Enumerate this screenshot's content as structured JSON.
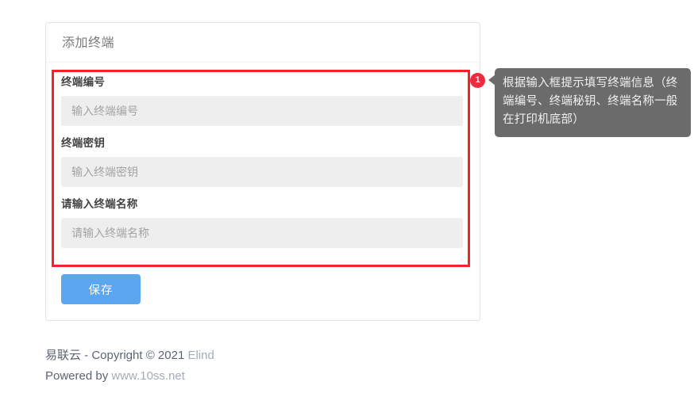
{
  "card": {
    "title": "添加终端",
    "fields": [
      {
        "label": "终端编号",
        "value": "",
        "placeholder": "输入终端编号"
      },
      {
        "label": "终端密钥",
        "value": "",
        "placeholder": "输入终端密钥"
      },
      {
        "label": "请输入终端名称",
        "value": "",
        "placeholder": "请输入终端名称"
      }
    ],
    "save_label": "保存"
  },
  "callout": {
    "badge": "1",
    "text": "根据输入框提示填写终端信息（终端编号、终端秘钥、终端名称一般在打印机底部）"
  },
  "footer": {
    "line1_prefix": "易联云 - Copyright © 2021 ",
    "line1_muted": "Elind",
    "line2_prefix": "Powered by ",
    "line2_muted": "www.10ss.net"
  },
  "colors": {
    "highlight": "#f22424",
    "badge": "#ed2b40",
    "tooltip_bg": "#6b6b6b",
    "save_button": "#5aa7ef",
    "input_bg": "#eeeeee"
  }
}
